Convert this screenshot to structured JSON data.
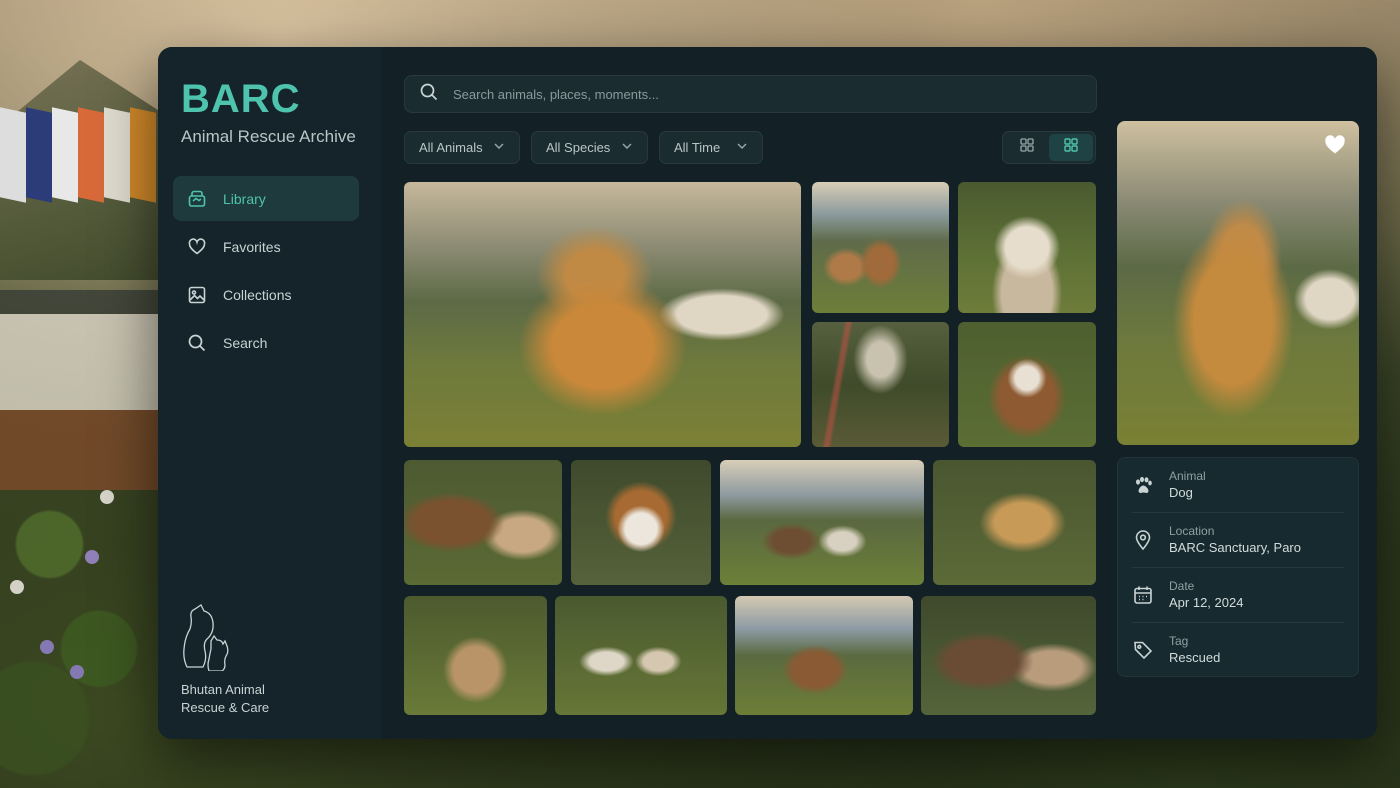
{
  "app": {
    "title": "BARC",
    "subtitle": "Animal Rescue Archive",
    "org_name_line1": "Bhutan Animal",
    "org_name_line2": "Rescue & Care"
  },
  "sidebar": {
    "items": [
      {
        "label": "Library",
        "icon": "library-icon",
        "active": true
      },
      {
        "label": "Favorites",
        "icon": "heart-icon",
        "active": false
      },
      {
        "label": "Collections",
        "icon": "image-icon",
        "active": false
      },
      {
        "label": "Search",
        "icon": "search-icon",
        "active": false
      }
    ]
  },
  "search": {
    "placeholder": "Search animals, places, moments..."
  },
  "filters": {
    "animals": "All Animals",
    "species": "All Species",
    "time": "All Time"
  },
  "view_toggle": {
    "options": [
      "grid-large-icon",
      "grid-small-icon"
    ],
    "selected": "grid-small-icon"
  },
  "gallery": {
    "photos": [
      {
        "subject": "dog",
        "scene": "dog-mountain-temple",
        "featured": true
      },
      {
        "subject": "cows",
        "scene": "herd-mountains"
      },
      {
        "subject": "goat",
        "scene": "goat-portrait"
      },
      {
        "subject": "forest",
        "scene": "forest-prayer-flags"
      },
      {
        "subject": "cow",
        "scene": "cow-portrait"
      },
      {
        "subject": "cows",
        "scene": "two-cows"
      },
      {
        "subject": "dog",
        "scene": "white-brown-dog"
      },
      {
        "subject": "goats",
        "scene": "goats-meadow"
      },
      {
        "subject": "dog",
        "scene": "golden-dog-smiling"
      },
      {
        "subject": "dog",
        "scene": "dog-lying-grass"
      },
      {
        "subject": "goats",
        "scene": "goats-group"
      },
      {
        "subject": "cow",
        "scene": "cow-mountain"
      },
      {
        "subject": "cows",
        "scene": "cows-closeup"
      }
    ]
  },
  "detail": {
    "favorite": true,
    "fields": [
      {
        "key": "Animal",
        "value": "Dog",
        "icon": "paw-icon"
      },
      {
        "key": "Location",
        "value": "BARC Sanctuary, Paro",
        "icon": "location-pin-icon"
      },
      {
        "key": "Date",
        "value": "Apr 12, 2024",
        "icon": "calendar-icon"
      },
      {
        "key": "Tag",
        "value": "Rescued",
        "icon": "tag-icon"
      }
    ]
  },
  "colors": {
    "accent": "#4ec3ad",
    "panel": "#142226",
    "text": "#c9d3d4"
  }
}
